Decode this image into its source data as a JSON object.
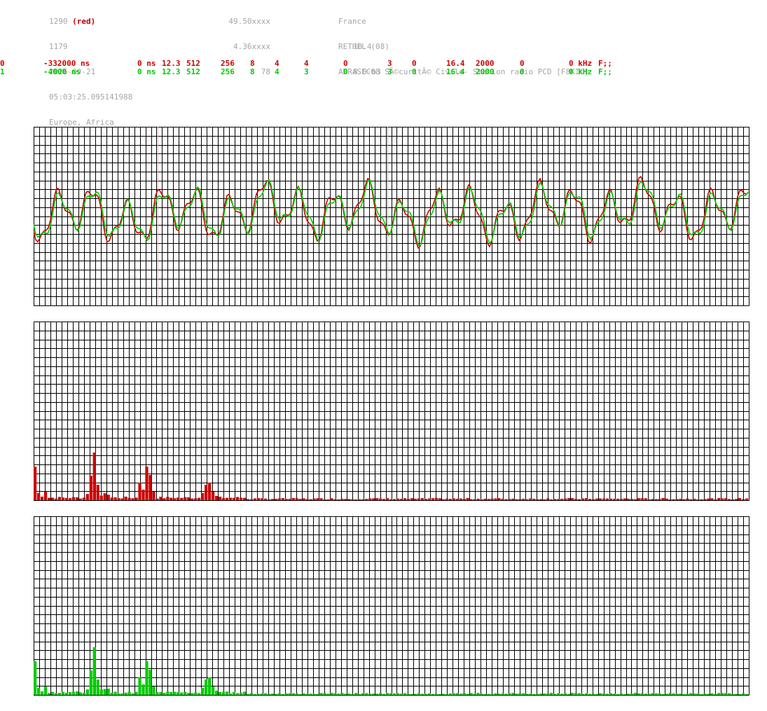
{
  "header": {
    "col1": [
      "1290",
      "1179",
      "2026-09-21",
      "05:03:25.095141988",
      "Europe, Africa"
    ],
    "col1_tag": "(red)",
    "col2": [
      "49.50xxxx",
      "4.36xxxx",
      "78"
    ],
    "col3": [
      "France",
      "RETHEL (08)",
      "ADRASEC08 SÃ©curitÃ© Civile- Station radio PCD [F8KIC]"
    ],
    "col4": [
      "10.4",
      "8.0-b3"
    ]
  },
  "channels": [
    {
      "name": "channel-0",
      "color": "#cc0000",
      "fields": [
        "0",
        "-332000 ns",
        "0 ns",
        "12.3",
        "512",
        "256",
        "8",
        "4",
        "4",
        "0",
        "3",
        "0",
        "16.4",
        "2000",
        "0",
        "0 kHz",
        "F;;"
      ]
    },
    {
      "name": "channel-1",
      "color": "#00cc00",
      "fields": [
        "1",
        "-4000 ns",
        "0 ns",
        "12.3",
        "512",
        "256",
        "8",
        "4",
        "3",
        "0",
        "3",
        "0",
        "16.4",
        "2000",
        "0",
        "0 kHz",
        "F;;"
      ]
    }
  ],
  "colors": {
    "grid": "#000000",
    "red": "#cc0000",
    "green": "#00cc00",
    "text": "#a6a6a6"
  }
}
